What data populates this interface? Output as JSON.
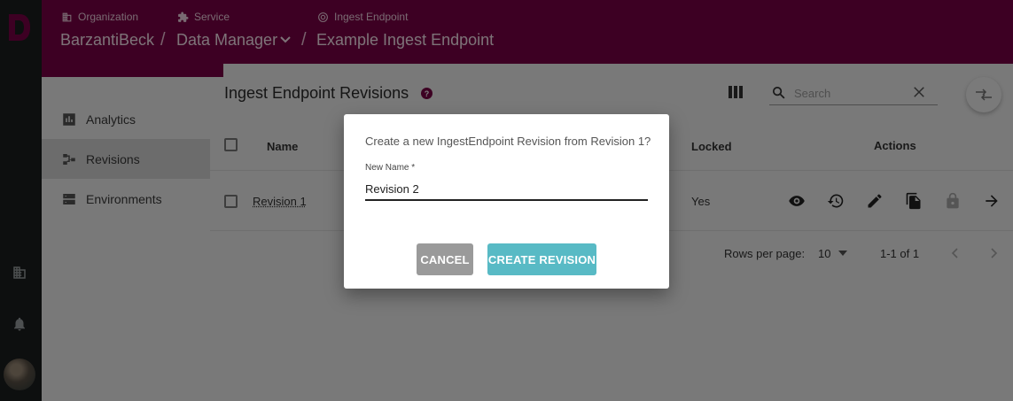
{
  "colors": {
    "brand": "#7b0046",
    "rail": "#1b1e1f",
    "accent": "#58bac5",
    "cancel": "#9a9a9a"
  },
  "breadcrumb": {
    "organization": {
      "icon": "building-icon",
      "label": "Organization",
      "value": "BarzantiBeck"
    },
    "service": {
      "icon": "puzzle-icon",
      "label": "Service",
      "value": "Data Manager"
    },
    "endpoint": {
      "icon": "ingest-icon",
      "label": "Ingest Endpoint",
      "value": "Example Ingest Endpoint"
    },
    "separator": "/"
  },
  "sidebar": {
    "items": [
      {
        "icon": "analytics-icon",
        "label": "Analytics"
      },
      {
        "icon": "revisions-icon",
        "label": "Revisions",
        "active": true
      },
      {
        "icon": "environments-icon",
        "label": "Environments"
      }
    ]
  },
  "main": {
    "title": "Ingest Endpoint Revisions",
    "help": "?",
    "search_placeholder": "Search",
    "columns": [
      "Name",
      "Locked",
      "Actions"
    ],
    "rows": [
      {
        "name": "Revision 1",
        "locked": "Yes"
      }
    ],
    "footer": {
      "rows_per_page_label": "Rows per page:",
      "rows_per_page": "10",
      "range": "1-1 of 1"
    }
  },
  "dialog": {
    "title": "Create a new IngestEndpoint Revision from Revision 1?",
    "field_label": "New Name *",
    "field_value": "Revision 2",
    "cancel_label": "CANCEL",
    "create_label": "CREATE REVISION"
  }
}
